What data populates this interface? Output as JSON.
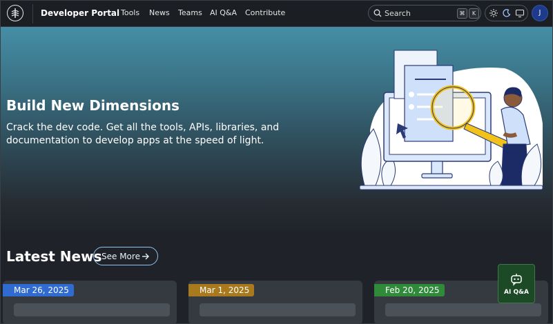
{
  "header": {
    "brand": "Developer Portal",
    "nav": [
      "Tools",
      "News",
      "Teams",
      "AI Q&A",
      "Contribute"
    ],
    "search_placeholder": "Search",
    "shortcut": [
      "⌘",
      "K"
    ],
    "avatar_initial": "J"
  },
  "hero": {
    "title": "Build New Dimensions",
    "subtitle": "Crack the dev code. Get all the tools, APIs, libraries, and documentation to develop apps at the speed of light."
  },
  "news": {
    "title": "Latest News",
    "see_more": "See More",
    "cards": [
      {
        "date": "Mar 26, 2025",
        "color": "#2f6bd0"
      },
      {
        "date": "Mar 1, 2025",
        "color": "#a8791d"
      },
      {
        "date": "Feb 20, 2025",
        "color": "#2f8a3a"
      }
    ]
  },
  "fab": {
    "label": "AI Q&A"
  }
}
